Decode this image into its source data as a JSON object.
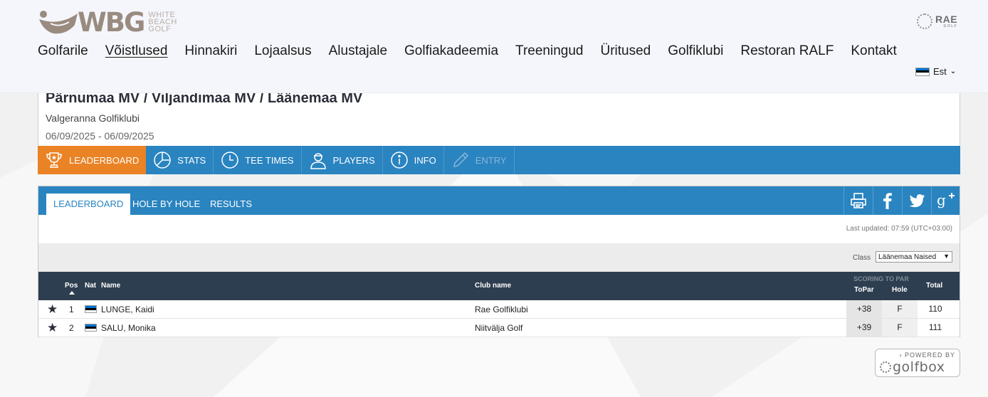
{
  "header": {
    "logo_text": "WBG",
    "logo_sub": [
      "WHITE",
      "BEACH",
      "GOLF"
    ],
    "partner_logo": {
      "big": "RAE",
      "small": "GOLF"
    },
    "nav": [
      {
        "label": "Golfarile",
        "active": false
      },
      {
        "label": "Võistlused",
        "active": true
      },
      {
        "label": "Hinnakiri",
        "active": false
      },
      {
        "label": "Lojaalsus",
        "active": false
      },
      {
        "label": "Alustajale",
        "active": false
      },
      {
        "label": "Golfiakadeemia",
        "active": false
      },
      {
        "label": "Treeningud",
        "active": false
      },
      {
        "label": "Üritused",
        "active": false
      },
      {
        "label": "Golfiklubi",
        "active": false
      },
      {
        "label": "Restoran RALF",
        "active": false
      },
      {
        "label": "Kontakt",
        "active": false
      }
    ],
    "language": {
      "label": "Est",
      "flag_colors": [
        "#0072ce",
        "#000000",
        "#ffffff"
      ]
    }
  },
  "event": {
    "title": "Pärnumaa MV / Viljandimaa MV / Läänemaa MV",
    "club": "Valgeranna Golfiklubi",
    "dates": "06/09/2025 - 06/09/2025",
    "tabs": [
      {
        "label": "LEADERBOARD",
        "icon": "trophy-icon",
        "state": "active"
      },
      {
        "label": "STATS",
        "icon": "pie-chart-icon",
        "state": "normal"
      },
      {
        "label": "TEE TIMES",
        "icon": "clock-icon",
        "state": "normal"
      },
      {
        "label": "PLAYERS",
        "icon": "player-icon",
        "state": "normal"
      },
      {
        "label": "INFO",
        "icon": "info-icon",
        "state": "normal"
      },
      {
        "label": "ENTRY",
        "icon": "pencil-icon",
        "state": "disabled"
      }
    ]
  },
  "leaderboard": {
    "subtabs": [
      "LEADERBOARD",
      "HOLE BY HOLE",
      "RESULTS"
    ],
    "share_icons": [
      "print-icon",
      "facebook-icon",
      "twitter-icon",
      "google-plus-icon"
    ],
    "last_updated": "Last updated: 07:59 (UTC+03:00)",
    "class_label": "Class",
    "class_selected": "Läänemaa Naised",
    "columns": {
      "pos": "Pos",
      "nat": "Nat",
      "name": "Name",
      "club": "Club name",
      "scoring_group": "SCORING TO PAR",
      "topar": "ToPar",
      "hole": "Hole",
      "total": "Total"
    },
    "rows": [
      {
        "pos": "1",
        "name": "LUNGE, Kaidi",
        "club": "Rae Golfiklubi",
        "topar": "+38",
        "hole": "F",
        "total": "110"
      },
      {
        "pos": "2",
        "name": "SALU, Monika",
        "club": "Niitvälja Golf",
        "topar": "+39",
        "hole": "F",
        "total": "111"
      }
    ]
  },
  "powered_by": {
    "label": "POWERED BY",
    "brand": "golfbox"
  },
  "colors": {
    "primary_blue": "#2a84c0",
    "active_orange": "#ea8325",
    "table_header": "#2d3e50"
  }
}
